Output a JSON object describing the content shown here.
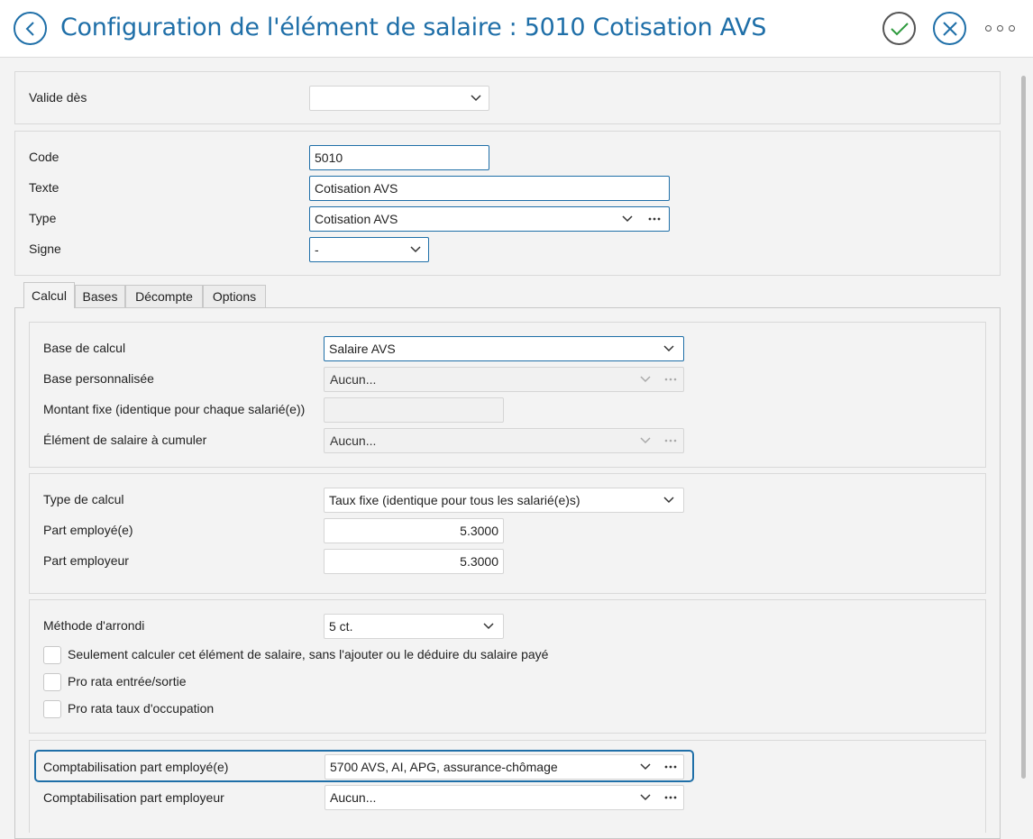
{
  "header": {
    "title": "Configuration de l'élément de salaire : 5010 Cotisation AVS",
    "back_icon": "chevron-left-icon",
    "ok_icon": "check-icon",
    "cancel_icon": "close-icon",
    "more_icon": "more-horizontal-icon"
  },
  "validity": {
    "label": "Valide dès",
    "value": ""
  },
  "general": {
    "code_label": "Code",
    "code_value": "5010",
    "text_label": "Texte",
    "text_value": "Cotisation AVS",
    "type_label": "Type",
    "type_value": "Cotisation AVS",
    "sign_label": "Signe",
    "sign_value": "-"
  },
  "tabs": [
    {
      "label": "Calcul"
    },
    {
      "label": "Bases"
    },
    {
      "label": "Décompte"
    },
    {
      "label": "Options"
    }
  ],
  "calcul": {
    "base_section": {
      "base_label": "Base de calcul",
      "base_value": "Salaire AVS",
      "custom_base_label": "Base personnalisée",
      "custom_base_value": "Aucun...",
      "fixed_amount_label": "Montant fixe (identique pour chaque salarié(e))",
      "fixed_amount_value": "",
      "cumulate_label": "Élément de salaire à cumuler",
      "cumulate_value": "Aucun..."
    },
    "rate_section": {
      "calc_type_label": "Type de calcul",
      "calc_type_value": "Taux fixe (identique pour tous les salarié(e)s)",
      "employee_part_label": "Part employé(e)",
      "employee_part_value": "5.3000",
      "employer_part_label": "Part employeur",
      "employer_part_value": "5.3000"
    },
    "rounding_section": {
      "rounding_label": "Méthode d'arrondi",
      "rounding_value": "5 ct.",
      "checkbox_only_calc": "Seulement calculer cet élément de salaire, sans l'ajouter ou le déduire du salaire payé",
      "checkbox_prorata_entry": "Pro rata entrée/sortie",
      "checkbox_prorata_rate": "Pro rata taux d'occupation"
    },
    "accounting_section": {
      "employee_account_label": "Comptabilisation part employé(e)",
      "employee_account_value": "5700 AVS, AI, APG, assurance-chômage",
      "employer_account_label": "Comptabilisation part employeur",
      "employer_account_value": "Aucun..."
    }
  }
}
